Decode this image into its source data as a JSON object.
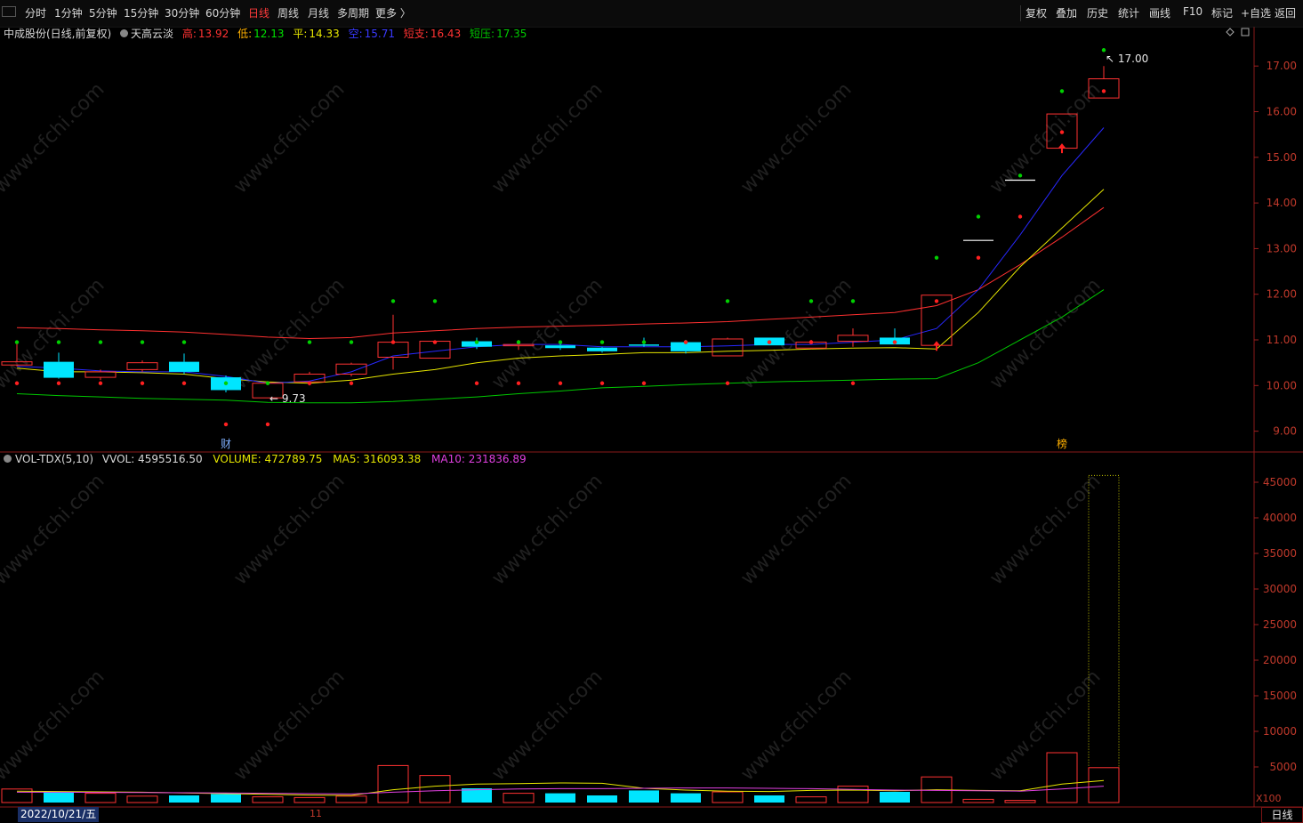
{
  "toolbar": {
    "menu_icon": "menu-icon",
    "periods": [
      "分时",
      "1分钟",
      "5分钟",
      "15分钟",
      "30分钟",
      "60分钟",
      "日线",
      "周线",
      "月线",
      "多周期",
      "更多 〉"
    ],
    "active_period": "日线",
    "right": [
      "复权",
      "叠加",
      "历史",
      "统计",
      "画线",
      "F10",
      "标记",
      "+自选",
      "返回"
    ]
  },
  "info": {
    "title": "中成股份(日线,前复权)",
    "indicator": "天高云淡",
    "hi_label": "高:",
    "hi_val": "13.92",
    "lo_label": "低:",
    "lo_val": "12.13",
    "ping_label": "平:",
    "ping_val": "14.33",
    "kong_label": "空:",
    "kong_val": "15.71",
    "dz_label": "短支:",
    "dz_val": "16.43",
    "dy_label": "短压:",
    "dy_val": "17.35"
  },
  "vol_info": {
    "name": "VOL-TDX(5,10)",
    "vvol": "VVOL: 4595516.50",
    "volume": "VOLUME: 472789.75",
    "ma5": "MA5: 316093.38",
    "ma10": "MA10: 231836.89"
  },
  "markers": {
    "cai": "财",
    "bang": "榜",
    "low_label": "9.73",
    "high_label": "17.00"
  },
  "footer": {
    "date": "2022/10/21/五",
    "month_tick": "11",
    "period_tab": "日线",
    "vol_unit": "X100"
  },
  "watermark": "www.cfchi.com",
  "colors": {
    "up": "#ff3232",
    "down": "#00e5ff",
    "ma_blue": "#2828ff",
    "ma_yellow": "#e6e600",
    "ma_red": "#ff3030",
    "ma_green": "#00c800",
    "magenta": "#e040e0"
  },
  "chart_data": [
    {
      "type": "candlestick",
      "title": "中成股份(日线,前复权)",
      "y_ticks": [
        9.0,
        10.0,
        11.0,
        12.0,
        13.0,
        14.0,
        15.0,
        16.0,
        17.0
      ],
      "ylim": [
        8.7,
        17.55
      ],
      "candles": [
        {
          "o": 10.45,
          "c": 10.52,
          "h": 10.95,
          "l": 10.42
        },
        {
          "o": 10.52,
          "c": 10.17,
          "h": 10.72,
          "l": 10.15
        },
        {
          "o": 10.18,
          "c": 10.3,
          "h": 10.35,
          "l": 10.12
        },
        {
          "o": 10.35,
          "c": 10.5,
          "h": 10.55,
          "l": 10.3
        },
        {
          "o": 10.52,
          "c": 10.3,
          "h": 10.7,
          "l": 10.25
        },
        {
          "o": 10.18,
          "c": 9.9,
          "h": 10.22,
          "l": 9.85
        },
        {
          "o": 9.73,
          "c": 10.05,
          "h": 10.1,
          "l": 9.73
        },
        {
          "o": 10.08,
          "c": 10.25,
          "h": 10.3,
          "l": 10.0
        },
        {
          "o": 10.25,
          "c": 10.47,
          "h": 10.5,
          "l": 10.2
        },
        {
          "o": 10.62,
          "c": 10.95,
          "h": 11.55,
          "l": 10.35
        },
        {
          "o": 10.6,
          "c": 10.97,
          "h": 10.97,
          "l": 10.6
        },
        {
          "o": 10.97,
          "c": 10.85,
          "h": 11.05,
          "l": 10.8
        },
        {
          "o": 10.88,
          "c": 10.9,
          "h": 11.0,
          "l": 10.78
        },
        {
          "o": 10.88,
          "c": 10.82,
          "h": 10.95,
          "l": 10.78
        },
        {
          "o": 10.83,
          "c": 10.75,
          "h": 10.85,
          "l": 10.72
        },
        {
          "o": 10.9,
          "c": 10.88,
          "h": 11.05,
          "l": 10.85
        },
        {
          "o": 10.95,
          "c": 10.75,
          "h": 11.0,
          "l": 10.7
        },
        {
          "o": 10.65,
          "c": 11.02,
          "h": 11.05,
          "l": 10.65
        },
        {
          "o": 11.05,
          "c": 10.88,
          "h": 11.05,
          "l": 10.88
        },
        {
          "o": 10.82,
          "c": 10.95,
          "h": 11.0,
          "l": 10.8
        },
        {
          "o": 10.97,
          "c": 11.1,
          "h": 11.25,
          "l": 10.85
        },
        {
          "o": 11.05,
          "c": 10.9,
          "h": 11.25,
          "l": 10.9
        },
        {
          "o": 10.88,
          "c": 11.98,
          "h": 11.98,
          "l": 10.85
        },
        {
          "o": 13.18,
          "c": 13.18,
          "h": 13.18,
          "l": 13.18
        },
        {
          "o": 14.5,
          "c": 14.5,
          "h": 14.5,
          "l": 14.5
        },
        {
          "o": 15.2,
          "c": 15.95,
          "h": 15.95,
          "l": 15.2
        },
        {
          "o": 16.3,
          "c": 16.72,
          "h": 17.0,
          "l": 16.3
        }
      ],
      "ma_blue": [
        10.42,
        10.38,
        10.32,
        10.3,
        10.3,
        10.2,
        10.05,
        10.1,
        10.3,
        10.65,
        10.75,
        10.85,
        10.9,
        10.9,
        10.85,
        10.85,
        10.85,
        10.87,
        10.9,
        10.9,
        10.95,
        11.0,
        11.25,
        12.1,
        13.3,
        14.6,
        15.65
      ],
      "ma_yellow": [
        10.38,
        10.3,
        10.3,
        10.28,
        10.25,
        10.15,
        10.08,
        10.05,
        10.12,
        10.25,
        10.35,
        10.5,
        10.6,
        10.65,
        10.68,
        10.72,
        10.72,
        10.75,
        10.77,
        10.8,
        10.82,
        10.83,
        10.8,
        11.6,
        12.6,
        13.45,
        14.3
      ],
      "ma_red": [
        11.27,
        11.25,
        11.22,
        11.2,
        11.17,
        11.12,
        11.06,
        11.03,
        11.05,
        11.15,
        11.2,
        11.25,
        11.28,
        11.3,
        11.32,
        11.35,
        11.37,
        11.4,
        11.45,
        11.5,
        11.55,
        11.6,
        11.75,
        12.1,
        12.65,
        13.25,
        13.9
      ],
      "ma_green": [
        9.82,
        9.78,
        9.75,
        9.72,
        9.7,
        9.68,
        9.63,
        9.62,
        9.62,
        9.65,
        9.7,
        9.75,
        9.82,
        9.88,
        9.95,
        9.98,
        10.02,
        10.05,
        10.08,
        10.1,
        10.12,
        10.14,
        10.15,
        10.5,
        11.0,
        11.5,
        12.1
      ],
      "green_dots": [
        10.95,
        10.95,
        10.95,
        10.95,
        10.95,
        10.05,
        10.05,
        10.95,
        10.95,
        11.85,
        11.85,
        10.95,
        10.95,
        10.95,
        10.95,
        10.95,
        10.95,
        11.85,
        10.95,
        11.85,
        11.85,
        10.95,
        12.8,
        13.7,
        14.6,
        16.45,
        17.35
      ],
      "red_dots": [
        10.05,
        10.05,
        10.05,
        10.05,
        10.05,
        9.15,
        9.15,
        10.05,
        10.05,
        10.95,
        10.95,
        10.05,
        10.05,
        10.05,
        10.05,
        10.05,
        10.95,
        10.05,
        10.95,
        10.95,
        10.05,
        10.95,
        11.85,
        12.8,
        13.7,
        15.55,
        16.45
      ],
      "low_marker": 9.73,
      "high_marker": 17.0
    },
    {
      "type": "bar",
      "title": "VOL-TDX(5,10)",
      "unit": "X100",
      "y_ticks": [
        5000,
        10000,
        15000,
        20000,
        25000,
        30000,
        35000,
        40000,
        45000
      ],
      "ylim": [
        0,
        47500
      ],
      "volumes": [
        1900,
        1500,
        1300,
        900,
        1000,
        1200,
        800,
        700,
        900,
        5200,
        3800,
        2000,
        1300,
        1300,
        1000,
        1700,
        1300,
        1500,
        1000,
        800,
        2300,
        1500,
        3600,
        450,
        300,
        7000,
        4900
      ],
      "vol_ma5": [
        1600,
        1550,
        1500,
        1450,
        1350,
        1250,
        1150,
        1050,
        1000,
        1800,
        2300,
        2600,
        2650,
        2750,
        2700,
        2000,
        1750,
        1600,
        1550,
        1700,
        1750,
        1650,
        1800,
        1700,
        1650,
        2600,
        3100
      ],
      "vol_ma10": [
        1450,
        1450,
        1420,
        1400,
        1380,
        1350,
        1300,
        1250,
        1200,
        1450,
        1650,
        1800,
        1900,
        1950,
        1950,
        2000,
        2050,
        2050,
        2000,
        1950,
        1850,
        1750,
        1700,
        1650,
        1600,
        1900,
        2300
      ],
      "highlight_vvol": 45955.165
    }
  ]
}
